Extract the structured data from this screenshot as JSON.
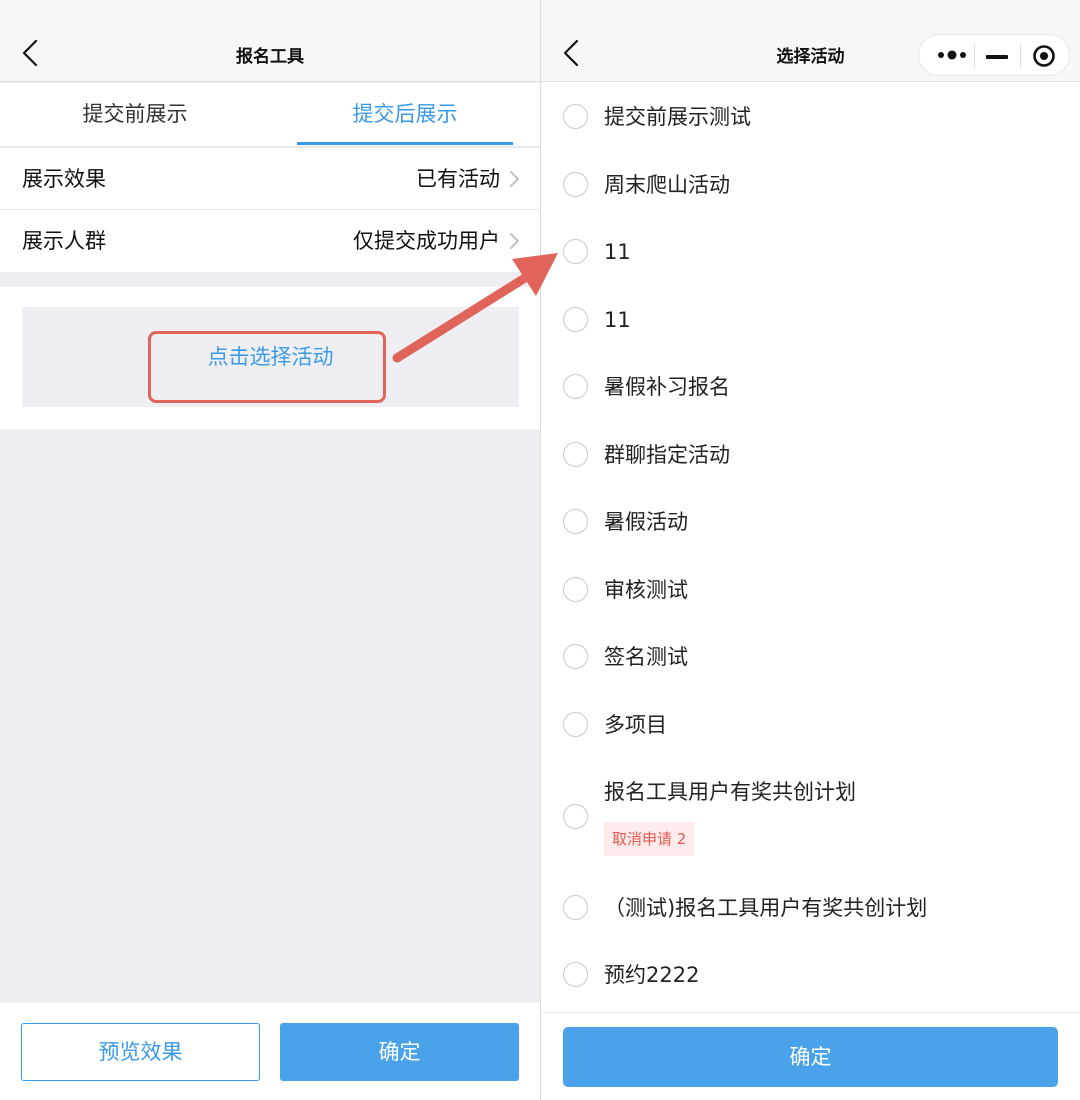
{
  "left": {
    "nav": {
      "title": "报名工具"
    },
    "tabs": [
      {
        "label": "提交前展示",
        "active": false
      },
      {
        "label": "提交后展示",
        "active": true
      }
    ],
    "rows": [
      {
        "label": "展示效果",
        "value": "已有活动"
      },
      {
        "label": "展示人群",
        "value": "仅提交成功用户"
      }
    ],
    "select_link": "点击选择活动",
    "footer": {
      "preview_label": "预览效果",
      "confirm_label": "确定"
    }
  },
  "right": {
    "nav": {
      "title": "选择活动"
    },
    "activities": [
      {
        "label": "提交前展示测试"
      },
      {
        "label": "周末爬山活动"
      },
      {
        "label": "11"
      },
      {
        "label": "11"
      },
      {
        "label": "暑假补习报名"
      },
      {
        "label": "群聊指定活动"
      },
      {
        "label": "暑假活动"
      },
      {
        "label": "审核测试"
      },
      {
        "label": "签名测试"
      },
      {
        "label": "多项目"
      },
      {
        "label": "报名工具用户有奖共创计划",
        "tag": "取消申请 2"
      },
      {
        "label": "（测试)报名工具用户有奖共创计划"
      },
      {
        "label": "预约2222"
      }
    ],
    "confirm_label": "确定"
  },
  "colors": {
    "accent": "#3a9ae8",
    "button_fill": "#4aa3ea",
    "annotation_red": "#e0645a",
    "tag_bg": "#fdeceb",
    "tag_text": "#e65a50"
  },
  "icons": {
    "back": "chevron-left-icon",
    "row_arrow": "chevron-right-icon",
    "more": "more-dots-icon",
    "minimize": "minimize-icon",
    "close": "target-close-icon"
  }
}
